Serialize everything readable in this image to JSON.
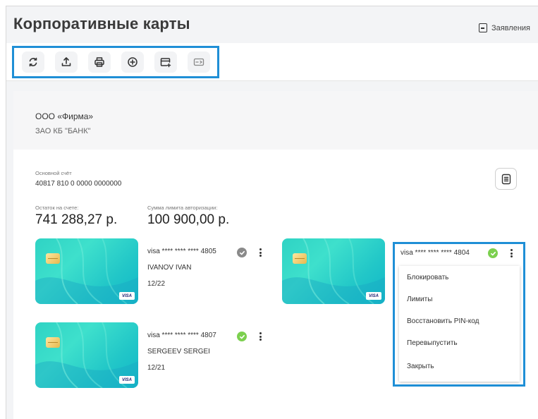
{
  "header": {
    "title": "Корпоративные карты",
    "applications_label": "Заявления"
  },
  "toolbar": {
    "buttons": [
      "refresh-icon",
      "upload-icon",
      "print-icon",
      "add-circle-icon",
      "card-add-icon",
      "card-icon"
    ]
  },
  "organization": {
    "name": "ООО «Фирма»",
    "bank": "ЗАО КБ \"БАНК\""
  },
  "account": {
    "label": "Основной счёт",
    "number": "40817 810 0 0000 0000000",
    "balance_label": "Остаток на счете:",
    "balance_value": "741 288,27 р.",
    "limit_label": "Сумма лимита авторизации:",
    "limit_value": "100 900,00 р."
  },
  "cards": [
    {
      "number": "visa **** **** **** 4805",
      "holder": "IVANOV IVAN",
      "expiry": "12/22",
      "status": "inactive",
      "brand": "VISA"
    },
    {
      "number": "visa **** **** **** 4804",
      "holder": "",
      "expiry": "",
      "status": "active",
      "brand": "VISA"
    },
    {
      "number": "visa **** **** **** 4807",
      "holder": "SERGEEV SERGEI",
      "expiry": "12/21",
      "status": "active",
      "brand": "VISA"
    }
  ],
  "card_menu": {
    "items": [
      "Блокировать",
      "Лимиты",
      "Восстановить PIN-код",
      "Перевыпустить",
      "Закрыть"
    ]
  },
  "colors": {
    "accent": "#1f8fd6",
    "status_active": "#7cd04f",
    "status_inactive": "#8a8a8a",
    "card_teal": "#2fd3c4"
  }
}
